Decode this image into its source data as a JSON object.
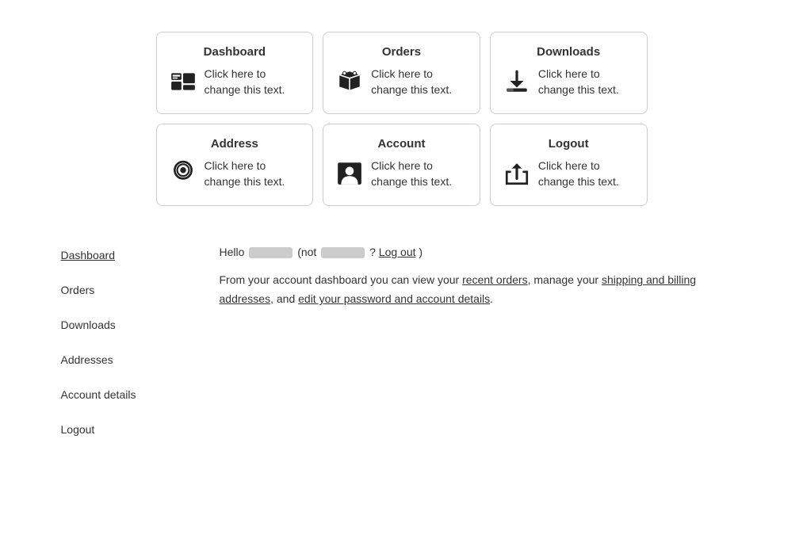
{
  "cards": [
    {
      "id": "dashboard",
      "title": "Dashboard",
      "text": "Click here to change this text.",
      "icon": "dashboard"
    },
    {
      "id": "orders",
      "title": "Orders",
      "text": "Click here to change this text.",
      "icon": "orders"
    },
    {
      "id": "downloads",
      "title": "Downloads",
      "text": "Click here to change this text.",
      "icon": "downloads"
    },
    {
      "id": "address",
      "title": "Address",
      "text": "Click here to change this text.",
      "icon": "address"
    },
    {
      "id": "account",
      "title": "Account",
      "text": "Click here to change this text.",
      "icon": "account"
    },
    {
      "id": "logout",
      "title": "Logout",
      "text": "Click here to change this text.",
      "icon": "logout"
    }
  ],
  "nav": {
    "items": [
      {
        "id": "dashboard",
        "label": "Dashboard",
        "active": true
      },
      {
        "id": "orders",
        "label": "Orders",
        "active": false
      },
      {
        "id": "downloads",
        "label": "Downloads",
        "active": false
      },
      {
        "id": "addresses",
        "label": "Addresses",
        "active": false
      },
      {
        "id": "account-details",
        "label": "Account details",
        "active": false
      },
      {
        "id": "logout",
        "label": "Logout",
        "active": false
      }
    ]
  },
  "main": {
    "hello_prefix": "Hello",
    "hello_not": "(not",
    "hello_suffix": "?",
    "logout_label": "Log out",
    "hello_close": ")",
    "description_line1": "From your account dashboard you can view your",
    "link_recent_orders": "recent orders",
    "description_mid1": ", manage your",
    "link_addresses": "shipping and billing addresses",
    "description_mid2": ", and",
    "link_account": "edit your password and account details",
    "description_end": "."
  }
}
